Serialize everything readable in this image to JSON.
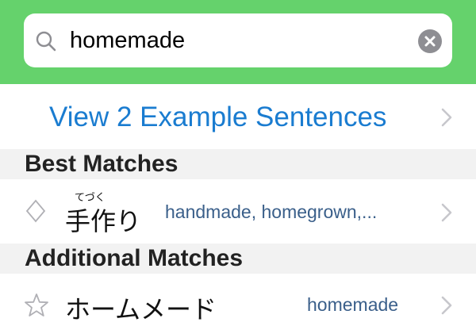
{
  "search": {
    "query": "homemade"
  },
  "examples": {
    "label": "View 2 Example Sentences"
  },
  "sections": {
    "best": "Best Matches",
    "additional": "Additional Matches"
  },
  "results": {
    "best": [
      {
        "word": "手作り",
        "reading": "てづく",
        "meaning": "handmade, homegrown,...",
        "icon": "diamond-icon"
      }
    ],
    "additional": [
      {
        "word": "ホームメード",
        "meaning": "homemade",
        "icon": "star-icon"
      }
    ]
  },
  "colors": {
    "header_green": "#65d26c",
    "link_blue": "#1a7cd0",
    "meaning_blue": "#3a5f8a"
  }
}
